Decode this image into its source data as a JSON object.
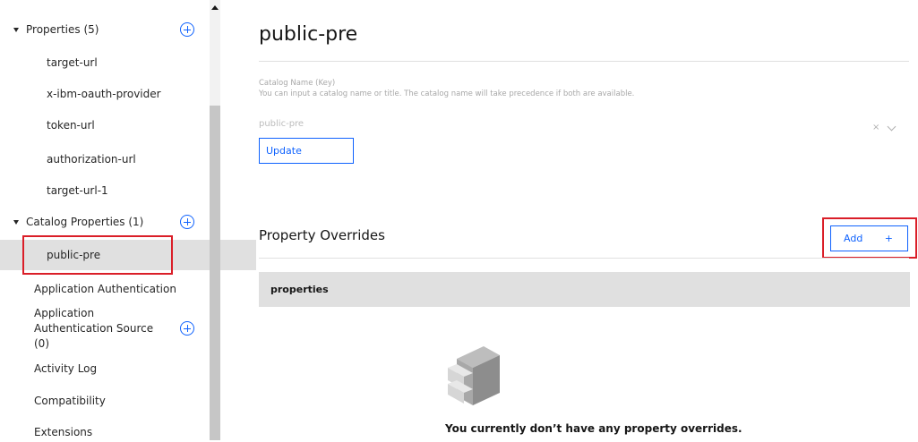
{
  "sidebar": {
    "properties_group": {
      "label": "Properties (5)"
    },
    "properties_items": [
      {
        "label": "target-url"
      },
      {
        "label": "x-ibm-oauth-provider"
      },
      {
        "label": "token-url"
      },
      {
        "label": "authorization-url"
      },
      {
        "label": "target-url-1"
      }
    ],
    "catalog_group": {
      "label": "Catalog Properties (1)"
    },
    "catalog_items": [
      {
        "label": "public-pre",
        "selected": true
      }
    ],
    "items": [
      {
        "label": "Application Authentication"
      },
      {
        "label": "Application Authentication Source (0)"
      },
      {
        "label": "Activity Log"
      },
      {
        "label": "Compatibility"
      },
      {
        "label": "Extensions"
      }
    ]
  },
  "main": {
    "title": "public-pre",
    "catalog_field": {
      "label": "Catalog Name (Key)",
      "help": "You can input a catalog name or title. The catalog name will take precedence if both are available.",
      "value": "public-pre",
      "clear_glyph": "×"
    },
    "update_label": "Update",
    "overrides": {
      "title": "Property Overrides",
      "add_label": "Add",
      "add_glyph": "+",
      "table_header": "properties",
      "empty_message": "You currently don’t have any property overrides."
    }
  },
  "colors": {
    "accent": "#0f62fe",
    "highlight": "#da1e28",
    "selected_bg": "#e0e0e0"
  },
  "icons": [
    "plus-circle-icon",
    "caret-down-icon",
    "chevron-down-icon",
    "close-icon",
    "file-cabinet-icon"
  ]
}
